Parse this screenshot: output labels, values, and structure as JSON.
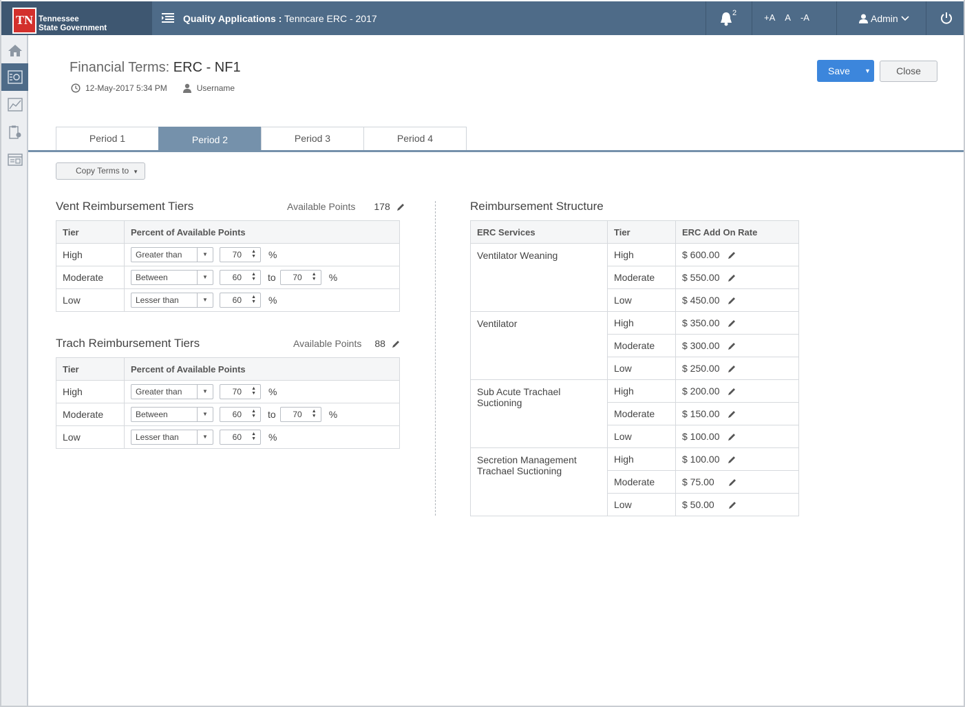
{
  "header": {
    "logo_abbr": "TN",
    "logo_line1": "Tennessee",
    "logo_line2": "State Government",
    "app_label": "Quality Applications :",
    "app_context": "Tenncare ERC - 2017",
    "notification_count": "2",
    "font_increase": "+A",
    "font_normal": "A",
    "font_decrease": "-A",
    "user_label": "Admin"
  },
  "page": {
    "title_prefix": "Financial Terms:",
    "title_value": "ERC - NF1",
    "timestamp": "12-May-2017 5:34 PM",
    "username": "Username",
    "save_label": "Save",
    "close_label": "Close"
  },
  "tabs": [
    {
      "label": "Period 1",
      "active": false
    },
    {
      "label": "Period 2",
      "active": true
    },
    {
      "label": "Period 3",
      "active": false
    },
    {
      "label": "Period 4",
      "active": false
    }
  ],
  "copy_terms_label": "Copy Terms to",
  "vent": {
    "title": "Vent Reimbursement Tiers",
    "available_label": "Available Points",
    "available_value": "178",
    "col_tier": "Tier",
    "col_percent": "Percent of Available Points",
    "rows": [
      {
        "tier": "High",
        "op": "Greater than",
        "v1": "70",
        "unit": "%"
      },
      {
        "tier": "Moderate",
        "op": "Between",
        "v1": "60",
        "to": "to",
        "v2": "70",
        "unit": "%"
      },
      {
        "tier": "Low",
        "op": "Lesser than",
        "v1": "60",
        "unit": "%"
      }
    ]
  },
  "trach": {
    "title": "Trach Reimbursement Tiers",
    "available_label": "Available Points",
    "available_value": "88",
    "col_tier": "Tier",
    "col_percent": "Percent of Available Points",
    "rows": [
      {
        "tier": "High",
        "op": "Greater than",
        "v1": "70",
        "unit": "%"
      },
      {
        "tier": "Moderate",
        "op": "Between",
        "v1": "60",
        "to": "to",
        "v2": "70",
        "unit": "%"
      },
      {
        "tier": "Low",
        "op": "Lesser than",
        "v1": "60",
        "unit": "%"
      }
    ]
  },
  "reimb": {
    "title": "Reimbursement Structure",
    "col_service": "ERC Services",
    "col_tier": "Tier",
    "col_rate": "ERC Add On Rate",
    "services": [
      {
        "name": "Ventilator Weaning",
        "tiers": [
          {
            "tier": "High",
            "rate": "$ 600.00"
          },
          {
            "tier": "Moderate",
            "rate": "$ 550.00"
          },
          {
            "tier": "Low",
            "rate": "$ 450.00"
          }
        ]
      },
      {
        "name": "Ventilator",
        "tiers": [
          {
            "tier": "High",
            "rate": "$ 350.00"
          },
          {
            "tier": "Moderate",
            "rate": "$ 300.00"
          },
          {
            "tier": "Low",
            "rate": "$ 250.00"
          }
        ]
      },
      {
        "name": "Sub Acute Trachael Suctioning",
        "tiers": [
          {
            "tier": "High",
            "rate": "$ 200.00"
          },
          {
            "tier": "Moderate",
            "rate": "$ 150.00"
          },
          {
            "tier": "Low",
            "rate": "$ 100.00"
          }
        ]
      },
      {
        "name": "Secretion Management Trachael Suctioning",
        "tiers": [
          {
            "tier": "High",
            "rate": "$ 100.00"
          },
          {
            "tier": "Moderate",
            "rate": "$ 75.00"
          },
          {
            "tier": "Low",
            "rate": "$ 50.00"
          }
        ]
      }
    ]
  },
  "colors": {
    "header_bg": "#4e6b88",
    "accent": "#3c86dc",
    "tab_active": "#7591ab",
    "logo_red": "#d3302c"
  }
}
